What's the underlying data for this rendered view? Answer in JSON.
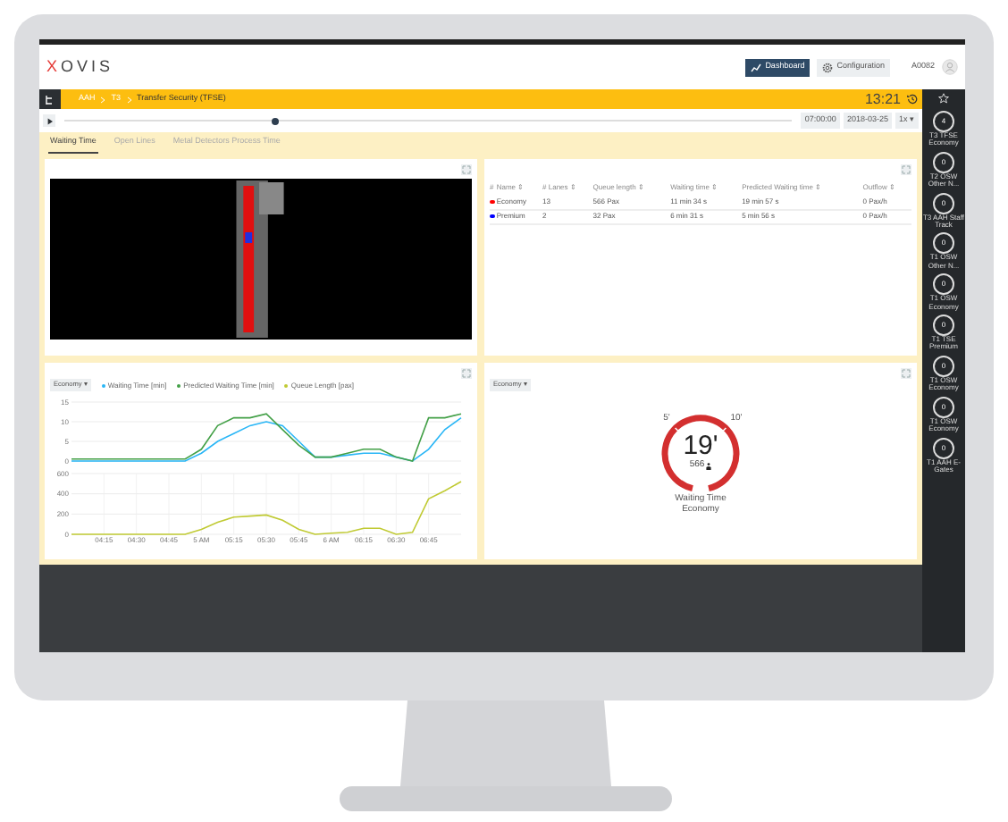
{
  "header": {
    "logo_first": "X",
    "logo_rest": "OVIS",
    "nav": [
      {
        "label": "Dashboard",
        "selected": true,
        "kind": "chart"
      },
      {
        "label": "Configuration",
        "selected": false,
        "kind": "gear"
      }
    ],
    "user": "A0082"
  },
  "breadcrumb": [
    "AAH",
    "T3",
    "Transfer Security (TFSE)"
  ],
  "clock": "13:21",
  "timeline": {
    "level": 0.29,
    "time": "07:00:00",
    "date": "2018-03-25",
    "speed": "1x ▾"
  },
  "tabs": [
    {
      "label": "Waiting Time",
      "selected": true
    },
    {
      "label": "Open Lines",
      "selected": false
    },
    {
      "label": "Metal Detectors Process Time",
      "selected": false
    }
  ],
  "table": {
    "columns": [
      "#",
      "Name ⇕",
      "# Lanes ⇕",
      "Queue length ⇕",
      "Waiting time ⇕",
      "Predicted Waiting time ⇕",
      "Outflow ⇕"
    ],
    "rows": [
      {
        "color": "#ff0000",
        "cells": [
          "",
          "Economy",
          "13",
          "566 Pax",
          "11 min 34 s",
          "19 min 57 s",
          "0 Pax/h"
        ]
      },
      {
        "color": "#0000ff",
        "cells": [
          "",
          "Premium",
          "2",
          "32 Pax",
          "6 min 31 s",
          "5 min 56 s",
          "0 Pax/h"
        ]
      }
    ]
  },
  "chart_panel": {
    "dropdown": "Economy ▾",
    "charts": [
      {
        "chart_data": {
          "type": "line",
          "grid": true,
          "categories": [
            null,
            null,
            null,
            null,
            null,
            null,
            null,
            null,
            null,
            null,
            null,
            null,
            null,
            null,
            null,
            null,
            null,
            null,
            null,
            null,
            null,
            null,
            null,
            null,
            null
          ],
          "ylim": [
            0,
            15
          ],
          "yticks": [
            0,
            5,
            10,
            15
          ],
          "series": [
            {
              "name": "Waiting Time [min]",
              "color": "#29b6f6",
              "values": [
                0,
                0,
                0,
                0,
                0,
                0,
                0,
                0,
                2,
                5,
                7,
                9,
                10,
                9,
                5,
                1,
                1,
                1.5,
                2,
                2,
                1,
                0,
                3,
                8,
                11
              ]
            },
            {
              "name": "Predicted Waiting Time [min]",
              "color": "#43a047",
              "values": [
                0.5,
                0.5,
                0.5,
                0.5,
                0.5,
                0.5,
                0.5,
                0.5,
                3,
                9,
                11,
                11,
                12,
                8,
                4,
                1,
                1,
                2,
                3,
                3,
                1,
                0,
                11,
                11,
                12
              ]
            }
          ]
        }
      },
      {
        "chart_data": {
          "type": "line",
          "grid": true,
          "categories": [
            null,
            null,
            "04:15",
            null,
            "04:30",
            null,
            "04:45",
            null,
            "5 AM",
            null,
            "05:15",
            null,
            "05:30",
            null,
            "05:45",
            null,
            "6 AM",
            null,
            "06:15",
            null,
            "06:30",
            null,
            "06:45",
            null,
            null
          ],
          "ylim": [
            0,
            600
          ],
          "yticks": [
            0,
            200,
            400,
            600
          ],
          "series": [
            {
              "name": "Queue Length [pax]",
              "color": "#c0ca33",
              "values": [
                0,
                0,
                0,
                0,
                0,
                0,
                0,
                0,
                50,
                120,
                170,
                180,
                190,
                140,
                50,
                0,
                10,
                20,
                60,
                60,
                0,
                20,
                350,
                430,
                520
              ]
            }
          ]
        }
      }
    ]
  },
  "gauge": {
    "dropdown": "Economy ▾",
    "ticks": [
      "5'",
      "10'"
    ],
    "value": "19'",
    "count": "566",
    "title": "Waiting Time",
    "subtitle": "Economy"
  },
  "sidebar": [
    {
      "value": "4",
      "label": "T3 TFSE Economy"
    },
    {
      "value": "0",
      "label": "T2 OSW Other N..."
    },
    {
      "value": "0",
      "label": "T3 AAH Staff Track"
    },
    {
      "value": "0",
      "label": "T1 OSW Other N..."
    },
    {
      "value": "0",
      "label": "T1 OSW Economy"
    },
    {
      "value": "0",
      "label": "T1 TSE Premium"
    },
    {
      "value": "0",
      "label": "T1 OSW Economy"
    },
    {
      "value": "0",
      "label": "T1 OSW Economy"
    },
    {
      "value": "0",
      "label": "T1 AAH E-Gates"
    }
  ]
}
